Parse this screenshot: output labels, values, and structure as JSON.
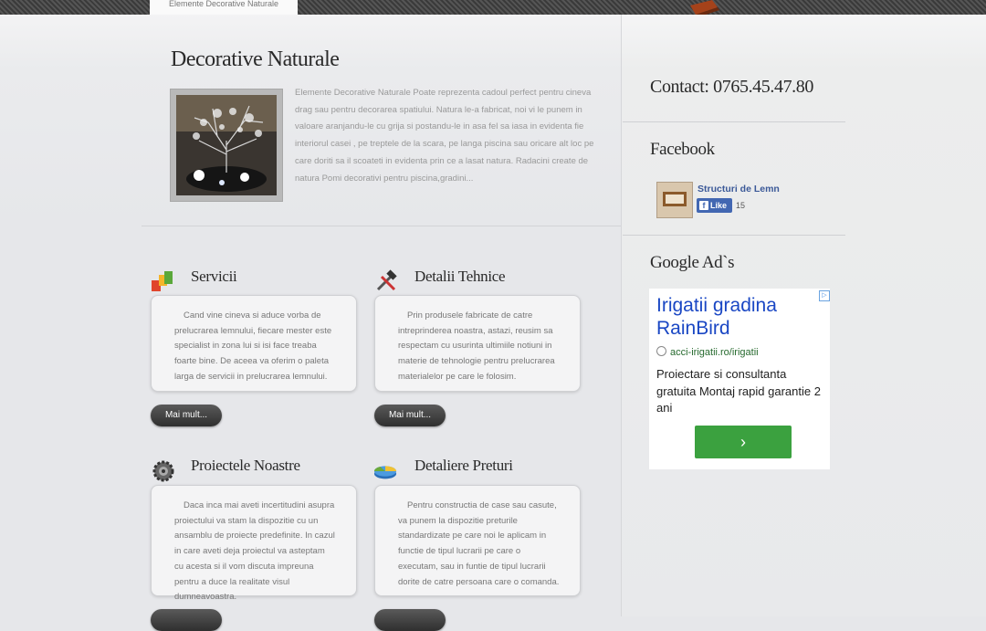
{
  "header": {
    "active_tab": "Elemente Decorative Naturale"
  },
  "featured": {
    "title": "Decorative Naturale",
    "text": "Elemente Decorative Naturale   Poate reprezenta cadoul perfect pentru cineva drag sau pentru decorarea spatiului. Natura le-a fabricat, noi vi le punem in valoare aranjandu-le  cu grija si postandu-le in asa fel sa iasa in evidenta fie interiorul casei , pe treptele de la scara, pe langa piscina sau oricare alt loc pe care doriti sa il scoateti in evidenta prin ce a lasat natura. Radacini create de natura Pomi decorativi pentru piscina,gradini..."
  },
  "boxes": [
    {
      "title": "Servicii",
      "icon": "blocks-icon",
      "text": "Cand vine cineva si aduce vorba de prelucrarea lemnului, fiecare mester  este specialist in zona lui si isi face treaba foarte bine.  De aceea va oferim o paleta larga de servicii in prelucrarea lemnului.",
      "button": "Mai mult..."
    },
    {
      "title": "Detalii Tehnice",
      "icon": "tools-icon",
      "text": "Prin  produsele  fabricate de catre intreprinderea noastra, astazi, reusim sa respectam cu usurinta ultimiile notiuni in materie de tehnologie pentru  prelucrarea materialelor  pe  care  le  folosim.",
      "button": "Mai mult..."
    },
    {
      "title": "Proiectele Noastre",
      "icon": "gear-icon",
      "text": "Daca inca mai aveti incertitudini  asupra proiectului va stam la dispozitie cu un ansamblu de proiecte predefinite.  In cazul in care aveti deja proiectul va asteptam cu acesta si  il vom discuta impreuna pentru a duce la realitate visul dumneavoastra.",
      "button": ""
    },
    {
      "title": "Detaliere Preturi",
      "icon": "pie-chart-icon",
      "text": "Pentru constructia de case sau casute, va punem la dispozitie preturile standardizate pe care noi le aplicam  in functie de tipul lucrarii pe care o executam, sau in funtie de tipul lucrarii dorite de catre persoana care o comanda.",
      "button": ""
    }
  ],
  "sidebar": {
    "contact": "Contact: 0765.45.47.80",
    "facebook_title": "Facebook",
    "fb_page": "Structuri de Lemn",
    "fb_like": "Like",
    "fb_count": "15",
    "ads_title": "Google Ad`s"
  },
  "ad": {
    "title": "Irigatii gradina RainBird",
    "url": "acci-irigatii.ro/irigatii",
    "desc": "Proiectare si consultanta gratuita Montaj rapid garantie 2 ani",
    "button_glyph": "›"
  }
}
